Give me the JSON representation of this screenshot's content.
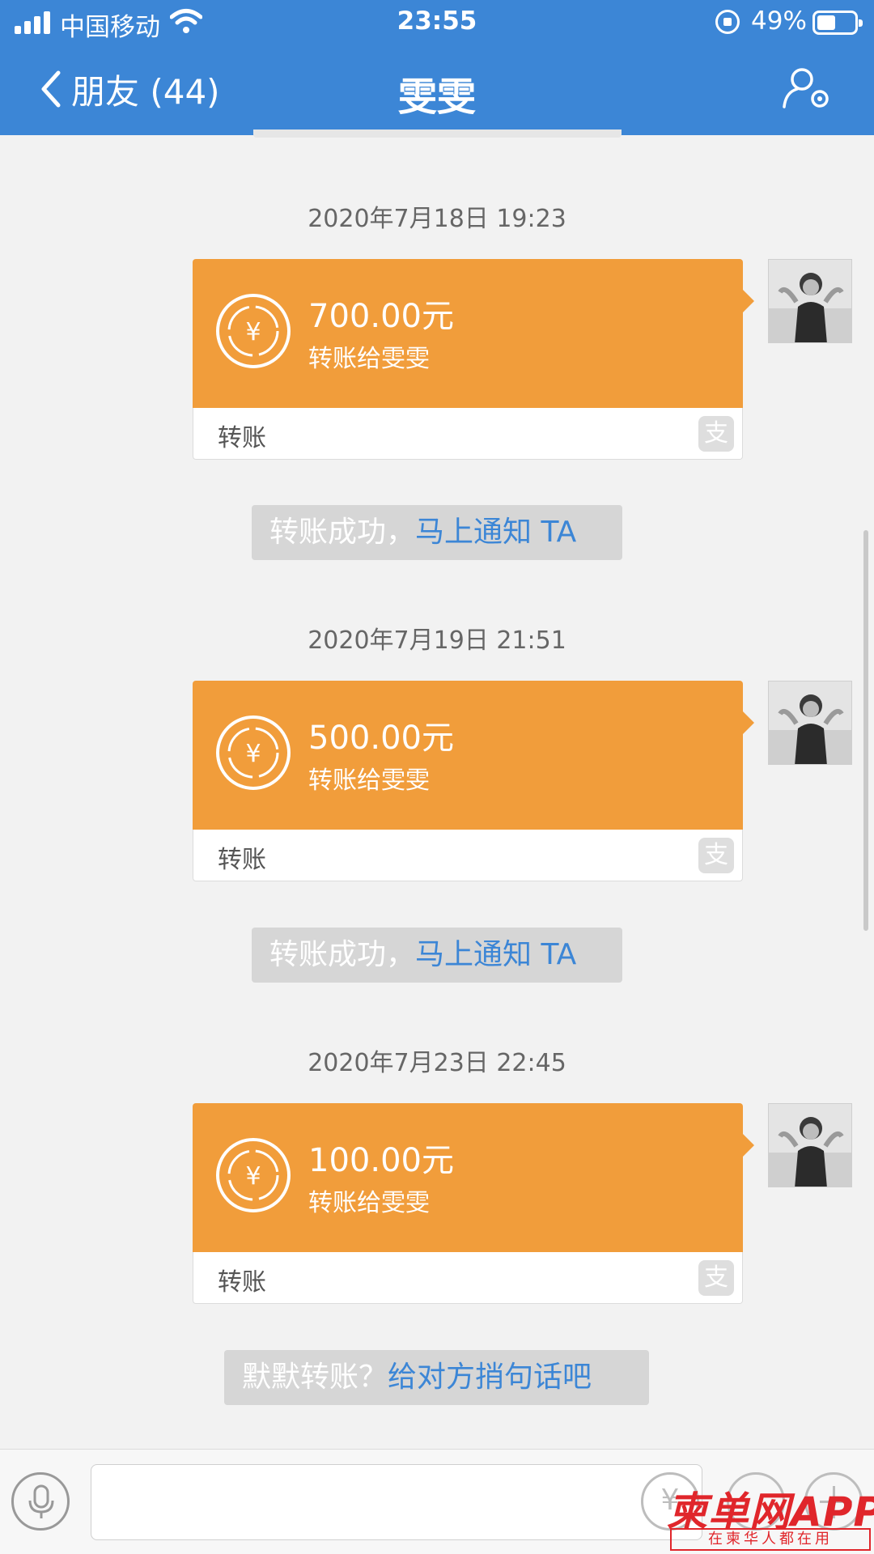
{
  "status_bar": {
    "carrier": "中国移动",
    "time": "23:55",
    "battery": "49%"
  },
  "nav": {
    "back_label": "朋友 (44)",
    "title": "雯雯"
  },
  "messages": [
    {
      "timestamp": "2020年7月18日 19:23",
      "amount": "700.00元",
      "description": "转账给雯雯",
      "label": "转账",
      "notice_text": "转账成功，",
      "notice_link": "马上通知 TA"
    },
    {
      "timestamp": "2020年7月19日 21:51",
      "amount": "500.00元",
      "description": "转账给雯雯",
      "label": "转账",
      "notice_text": "转账成功，",
      "notice_link": "马上通知 TA"
    },
    {
      "timestamp": "2020年7月23日 22:45",
      "amount": "100.00元",
      "description": "转账给雯雯",
      "label": "转账",
      "notice_text": "默默转账？",
      "notice_link": "给对方捎句话吧"
    }
  ],
  "card_icon": "yuan-transfer-icon",
  "alipay_mark": "支",
  "input_bar": {
    "coin_symbol": "¥"
  },
  "watermark": {
    "main": "柬单网APP",
    "sub": "在柬华人都在用"
  },
  "colors": {
    "header": "#3c86d6",
    "card": "#f19d3b",
    "link": "#3c86d6",
    "watermark": "#e0262b"
  }
}
